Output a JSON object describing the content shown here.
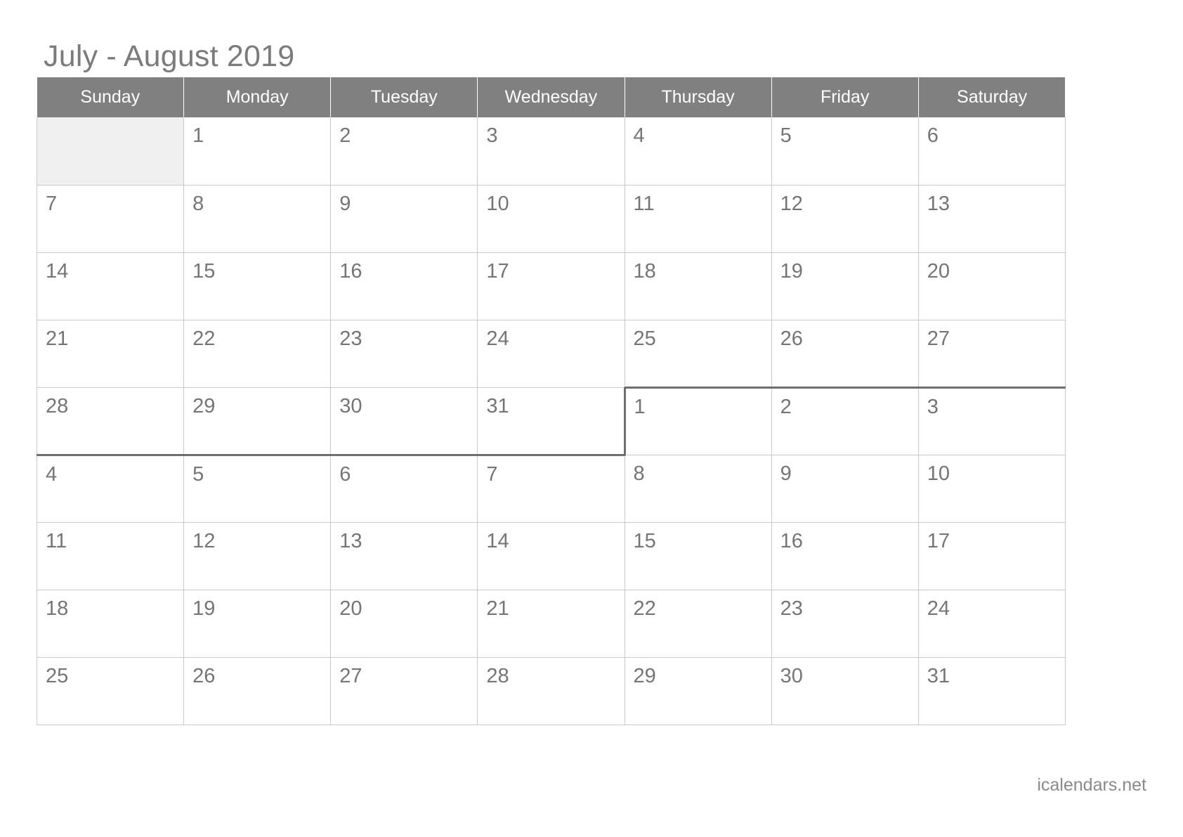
{
  "page": {
    "title": "July - August 2019",
    "footer": "icalendars.net",
    "background_color": "#ffffff",
    "header_bg_color": "#808080",
    "header_text_color": "#ffffff",
    "day_text_color": "#757575",
    "title_color": "#7b7b7b",
    "grid_line_color": "#c9c9c9",
    "month_boundary_color": "#6e6e6e",
    "blank_cell_color": "#f0f0f0"
  },
  "calendar": {
    "months": [
      "July",
      "August"
    ],
    "year": "2019",
    "week_start": "Sunday",
    "weekday_headers": [
      {
        "label": "Sunday"
      },
      {
        "label": "Monday"
      },
      {
        "label": "Tuesday"
      },
      {
        "label": "Wednesday"
      },
      {
        "label": "Thursday"
      },
      {
        "label": "Friday"
      },
      {
        "label": "Saturday"
      }
    ],
    "weeks": [
      {
        "cells": [
          {
            "day": "",
            "blank": true,
            "month": ""
          },
          {
            "day": "1",
            "blank": false,
            "month": "July"
          },
          {
            "day": "2",
            "blank": false,
            "month": "July"
          },
          {
            "day": "3",
            "blank": false,
            "month": "July"
          },
          {
            "day": "4",
            "blank": false,
            "month": "July"
          },
          {
            "day": "5",
            "blank": false,
            "month": "July"
          },
          {
            "day": "6",
            "blank": false,
            "month": "July"
          }
        ]
      },
      {
        "cells": [
          {
            "day": "7",
            "blank": false,
            "month": "July"
          },
          {
            "day": "8",
            "blank": false,
            "month": "July"
          },
          {
            "day": "9",
            "blank": false,
            "month": "July"
          },
          {
            "day": "10",
            "blank": false,
            "month": "July"
          },
          {
            "day": "11",
            "blank": false,
            "month": "July"
          },
          {
            "day": "12",
            "blank": false,
            "month": "July"
          },
          {
            "day": "13",
            "blank": false,
            "month": "July"
          }
        ]
      },
      {
        "cells": [
          {
            "day": "14",
            "blank": false,
            "month": "July"
          },
          {
            "day": "15",
            "blank": false,
            "month": "July"
          },
          {
            "day": "16",
            "blank": false,
            "month": "July"
          },
          {
            "day": "17",
            "blank": false,
            "month": "July"
          },
          {
            "day": "18",
            "blank": false,
            "month": "July"
          },
          {
            "day": "19",
            "blank": false,
            "month": "July"
          },
          {
            "day": "20",
            "blank": false,
            "month": "July"
          }
        ]
      },
      {
        "cells": [
          {
            "day": "21",
            "blank": false,
            "month": "July"
          },
          {
            "day": "22",
            "blank": false,
            "month": "July"
          },
          {
            "day": "23",
            "blank": false,
            "month": "July"
          },
          {
            "day": "24",
            "blank": false,
            "month": "July"
          },
          {
            "day": "25",
            "blank": false,
            "month": "July"
          },
          {
            "day": "26",
            "blank": false,
            "month": "July"
          },
          {
            "day": "27",
            "blank": false,
            "month": "July"
          }
        ]
      },
      {
        "cells": [
          {
            "day": "28",
            "blank": false,
            "month": "July"
          },
          {
            "day": "29",
            "blank": false,
            "month": "July"
          },
          {
            "day": "30",
            "blank": false,
            "month": "July"
          },
          {
            "day": "31",
            "blank": false,
            "month": "July"
          },
          {
            "day": "1",
            "blank": false,
            "month": "August"
          },
          {
            "day": "2",
            "blank": false,
            "month": "August"
          },
          {
            "day": "3",
            "blank": false,
            "month": "August"
          }
        ]
      },
      {
        "cells": [
          {
            "day": "4",
            "blank": false,
            "month": "August"
          },
          {
            "day": "5",
            "blank": false,
            "month": "August"
          },
          {
            "day": "6",
            "blank": false,
            "month": "August"
          },
          {
            "day": "7",
            "blank": false,
            "month": "August"
          },
          {
            "day": "8",
            "blank": false,
            "month": "August"
          },
          {
            "day": "9",
            "blank": false,
            "month": "August"
          },
          {
            "day": "10",
            "blank": false,
            "month": "August"
          }
        ]
      },
      {
        "cells": [
          {
            "day": "11",
            "blank": false,
            "month": "August"
          },
          {
            "day": "12",
            "blank": false,
            "month": "August"
          },
          {
            "day": "13",
            "blank": false,
            "month": "August"
          },
          {
            "day": "14",
            "blank": false,
            "month": "August"
          },
          {
            "day": "15",
            "blank": false,
            "month": "August"
          },
          {
            "day": "16",
            "blank": false,
            "month": "August"
          },
          {
            "day": "17",
            "blank": false,
            "month": "August"
          }
        ]
      },
      {
        "cells": [
          {
            "day": "18",
            "blank": false,
            "month": "August"
          },
          {
            "day": "19",
            "blank": false,
            "month": "August"
          },
          {
            "day": "20",
            "blank": false,
            "month": "August"
          },
          {
            "day": "21",
            "blank": false,
            "month": "August"
          },
          {
            "day": "22",
            "blank": false,
            "month": "August"
          },
          {
            "day": "23",
            "blank": false,
            "month": "August"
          },
          {
            "day": "24",
            "blank": false,
            "month": "August"
          }
        ]
      },
      {
        "cells": [
          {
            "day": "25",
            "blank": false,
            "month": "August"
          },
          {
            "day": "26",
            "blank": false,
            "month": "August"
          },
          {
            "day": "27",
            "blank": false,
            "month": "August"
          },
          {
            "day": "28",
            "blank": false,
            "month": "August"
          },
          {
            "day": "29",
            "blank": false,
            "month": "August"
          },
          {
            "day": "30",
            "blank": false,
            "month": "August"
          },
          {
            "day": "31",
            "blank": false,
            "month": "August"
          }
        ]
      }
    ]
  }
}
